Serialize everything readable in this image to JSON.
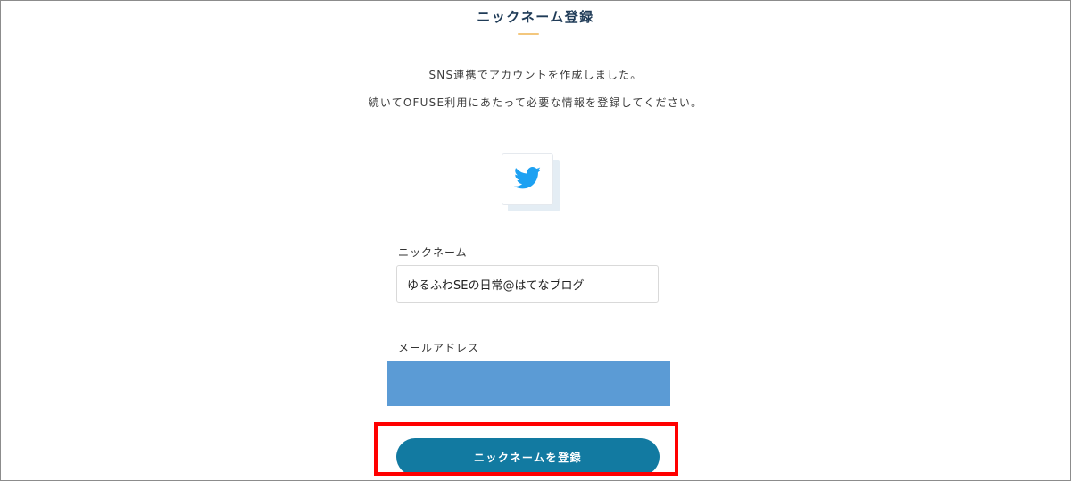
{
  "page": {
    "title": "ニックネーム登録",
    "accent_color": "#f3c77d"
  },
  "intro": {
    "line1": "SNS連携でアカウントを作成しました。",
    "line2": "続いてOFUSE利用にあたって必要な情報を登録してください。"
  },
  "sns": {
    "icon": "twitter-bird-icon",
    "icon_color": "#1da1f2"
  },
  "form": {
    "nickname_label": "ニックネーム",
    "nickname_value": "ゆるふわSEの日常@はてなブログ",
    "email_label": "メールアドレス",
    "email_redaction_color": "#5b9bd5",
    "submit_label": "ニックネームを登録",
    "submit_color": "#127aa1"
  },
  "annotation": {
    "highlight_color": "#ff0000"
  }
}
